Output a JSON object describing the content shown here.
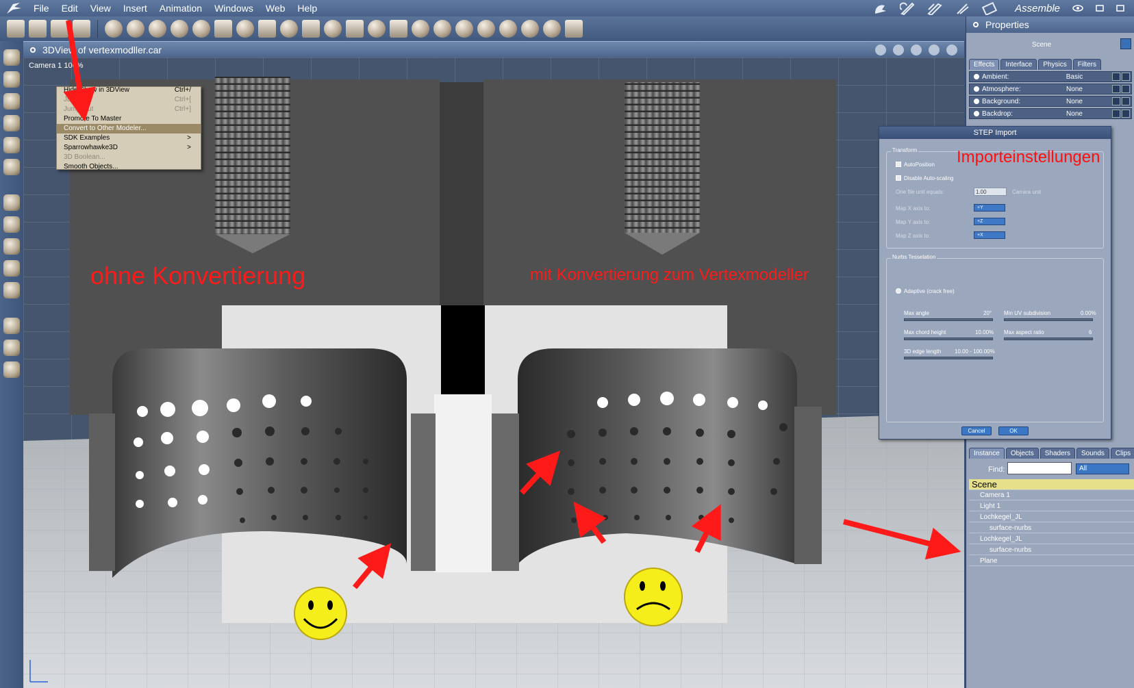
{
  "menubar": {
    "items": [
      "File",
      "Edit",
      "View",
      "Insert",
      "Animation",
      "Windows",
      "Web",
      "Help"
    ],
    "room_label": "Assemble"
  },
  "view": {
    "title": "3DView of vertexmodller.car",
    "camera_label": "Camera 1 100%"
  },
  "context_menu": {
    "items": [
      {
        "label": "Hide/Show in 3DView",
        "shortcut": "Ctrl+/",
        "state": "partial"
      },
      {
        "label": "Jump",
        "shortcut": "Ctrl+[",
        "state": "disabled"
      },
      {
        "label": "Jump Out",
        "shortcut": "Ctrl+]",
        "state": "disabled"
      },
      {
        "label": "Promote To Master",
        "shortcut": "",
        "state": "normal"
      },
      {
        "label": "Convert to Other Modeler...",
        "shortcut": "",
        "state": "highlighted"
      },
      {
        "label": "SDK Examples",
        "shortcut": ">",
        "state": "normal"
      },
      {
        "label": "Sparrowhawke3D",
        "shortcut": ">",
        "state": "normal"
      },
      {
        "label": "3D Boolean...",
        "shortcut": "",
        "state": "disabled"
      },
      {
        "label": "Smooth Objects...",
        "shortcut": "",
        "state": "normal"
      }
    ]
  },
  "properties": {
    "title": "Properties",
    "scene_label": "Scene",
    "tabs": [
      "Effects",
      "Interface",
      "Physics",
      "Filters"
    ],
    "rows": [
      {
        "name": "Ambient:",
        "value": "Basic"
      },
      {
        "name": "Atmosphere:",
        "value": "None"
      },
      {
        "name": "Background:",
        "value": "None"
      },
      {
        "name": "Backdrop:",
        "value": "None"
      }
    ]
  },
  "step_dialog": {
    "title": "STEP Import",
    "transform_label": "Transform",
    "auto_position": "AutoPosition",
    "disable_autoscaling": "Disable Auto-scaling",
    "unit_label": "One file unit equals:",
    "unit_value": "1.00",
    "unit_suffix": "Carrara unit",
    "map_x": "Map X axis to:",
    "map_x_val": "+Y",
    "map_y": "Map Y axis to:",
    "map_y_val": "+Z",
    "map_z": "Map Z axis to:",
    "map_z_val": "+X",
    "nurbs_label": "Nurbs Tesselation",
    "adaptive": "Adaptive (crack free)",
    "max_angle": "Max angle",
    "max_angle_val": "20°",
    "min_uv": "Min UV subdivision",
    "min_uv_val": "0.00%",
    "max_chord": "Max chord height",
    "max_chord_val": "10.00%",
    "max_aspect": "Max aspect ratio",
    "max_aspect_val": "6",
    "edge_len": "3D edge length",
    "edge_len_val": "10.00 - 100.00%",
    "cancel": "Cancel",
    "ok": "OK"
  },
  "instance_panel": {
    "tabs": [
      "Instance",
      "Objects",
      "Shaders",
      "Sounds",
      "Clips"
    ],
    "find_label": "Find:",
    "find_filter": "All",
    "tree": [
      {
        "label": "Scene",
        "level": 0,
        "type": "root"
      },
      {
        "label": "Camera 1",
        "level": 1
      },
      {
        "label": "Light 1",
        "level": 1
      },
      {
        "label": "Lochkegel_JL",
        "level": 1,
        "expanded": true
      },
      {
        "label": "surface-nurbs",
        "level": 2
      },
      {
        "label": "Lochkegel_JL",
        "level": 1,
        "expanded": true
      },
      {
        "label": "surface-nurbs",
        "level": 2
      },
      {
        "label": "Plane",
        "level": 1
      }
    ]
  },
  "annotations": {
    "left_label": "ohne Konvertierung",
    "right_label": "mit Konvertierung zum Vertexmodeller",
    "import_label": "Importeinstellungen"
  },
  "colors": {
    "annotation_red": "#ff1a1a",
    "ui_blue": "#4a6289",
    "panel_gray": "#9aa6bc",
    "highlight": "#9b8a66"
  }
}
